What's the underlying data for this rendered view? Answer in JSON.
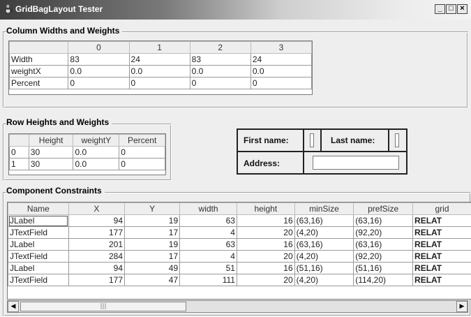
{
  "window": {
    "title": "GridBagLayout Tester",
    "icon": "java-cup-icon",
    "buttons": [
      "_",
      "□",
      "×"
    ]
  },
  "column_section": {
    "title": "Column Widths and Weights",
    "headers": [
      "",
      "0",
      "1",
      "2",
      "3"
    ],
    "rows": [
      {
        "label": "Width",
        "values": [
          "83",
          "24",
          "83",
          "24"
        ]
      },
      {
        "label": "weightX",
        "values": [
          "0.0",
          "0.0",
          "0.0",
          "0.0"
        ]
      },
      {
        "label": "Percent",
        "values": [
          "0",
          "0",
          "0",
          "0"
        ]
      }
    ]
  },
  "row_section": {
    "title": "Row Heights and Weights",
    "headers": [
      "",
      "Height",
      "weightY",
      "Percent"
    ],
    "rows": [
      {
        "index": "0",
        "height": "30",
        "weight": "0.0",
        "percent": "0"
      },
      {
        "index": "1",
        "height": "30",
        "weight": "0.0",
        "percent": "0"
      }
    ]
  },
  "preview": {
    "first_name": "First name:",
    "last_name": "Last name:",
    "address": "Address:"
  },
  "constraints_section": {
    "title": "Component Constraints",
    "headers": [
      "Name",
      "X",
      "Y",
      "width",
      "height",
      "minSize",
      "prefSize",
      "grid"
    ],
    "rows": [
      [
        "JLabel",
        "94",
        "19",
        "63",
        "16",
        "(63,16)",
        "(63,16)",
        "RELAT"
      ],
      [
        "JTextField",
        "177",
        "17",
        "4",
        "20",
        "(4,20)",
        "(92,20)",
        "RELAT"
      ],
      [
        "JLabel",
        "201",
        "19",
        "63",
        "16",
        "(63,16)",
        "(63,16)",
        "RELAT"
      ],
      [
        "JTextField",
        "284",
        "17",
        "4",
        "20",
        "(4,20)",
        "(92,20)",
        "RELAT"
      ],
      [
        "JLabel",
        "94",
        "49",
        "51",
        "16",
        "(51,16)",
        "(51,16)",
        "RELAT"
      ],
      [
        "JTextField",
        "177",
        "47",
        "111",
        "20",
        "(4,20)",
        "(114,20)",
        "RELAT"
      ]
    ]
  },
  "scrollbar": {
    "left_arrow": "◀",
    "right_arrow": "▶",
    "thumb_grip": "|||"
  }
}
